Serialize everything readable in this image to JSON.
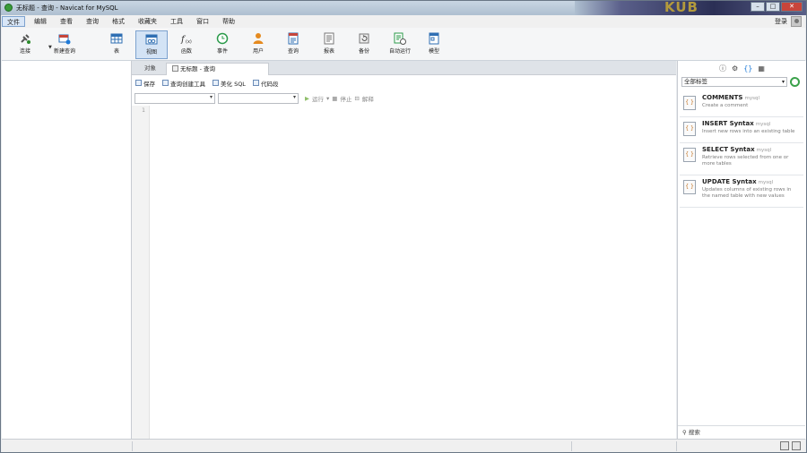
{
  "window": {
    "title": "无标题 - 查询 - Navicat for MySQL",
    "banner_text": "KUB"
  },
  "menu": [
    "文件",
    "编辑",
    "查看",
    "查询",
    "格式",
    "收藏夹",
    "工具",
    "窗口",
    "帮助"
  ],
  "user": {
    "label": "登录"
  },
  "toolbar": [
    {
      "name": "connection",
      "label": "连接",
      "icon": "plug-icon"
    },
    {
      "name": "new-query",
      "label": "新建查询",
      "icon": "new-query-icon"
    },
    {
      "name": "table",
      "label": "表",
      "icon": "table-icon"
    },
    {
      "name": "view",
      "label": "视图",
      "icon": "view-icon"
    },
    {
      "name": "function",
      "label": "函数",
      "icon": "function-icon"
    },
    {
      "name": "event",
      "label": "事件",
      "icon": "clock-icon"
    },
    {
      "name": "user",
      "label": "用户",
      "icon": "user-icon"
    },
    {
      "name": "query",
      "label": "查询",
      "icon": "query-icon"
    },
    {
      "name": "report",
      "label": "报表",
      "icon": "report-icon"
    },
    {
      "name": "backup",
      "label": "备份",
      "icon": "backup-icon"
    },
    {
      "name": "schedule",
      "label": "自动运行",
      "icon": "schedule-icon"
    },
    {
      "name": "model",
      "label": "模型",
      "icon": "model-icon"
    }
  ],
  "tabs": {
    "objects": "对象",
    "query": "无标题 - 查询"
  },
  "query_toolbar": {
    "save": "保存",
    "builder": "查询创建工具",
    "beautify": "美化 SQL",
    "snippet": "代码段"
  },
  "run_bar": {
    "run": "运行",
    "stop": "停止",
    "explain": "解释"
  },
  "editor": {
    "line_number": "1"
  },
  "right_panel": {
    "select": "全部标签",
    "snippets": [
      {
        "title": "COMMENTS",
        "tag": "mysql",
        "desc": "Create a comment"
      },
      {
        "title": "INSERT Syntax",
        "tag": "mysql",
        "desc": "Insert new rows into an existing table"
      },
      {
        "title": "SELECT Syntax",
        "tag": "mysql",
        "desc": "Retrieve rows selected from one or more tables"
      },
      {
        "title": "UPDATE Syntax",
        "tag": "mysql",
        "desc": "Updates columns of existing rows in the named table with new values"
      }
    ],
    "search": "搜索"
  }
}
